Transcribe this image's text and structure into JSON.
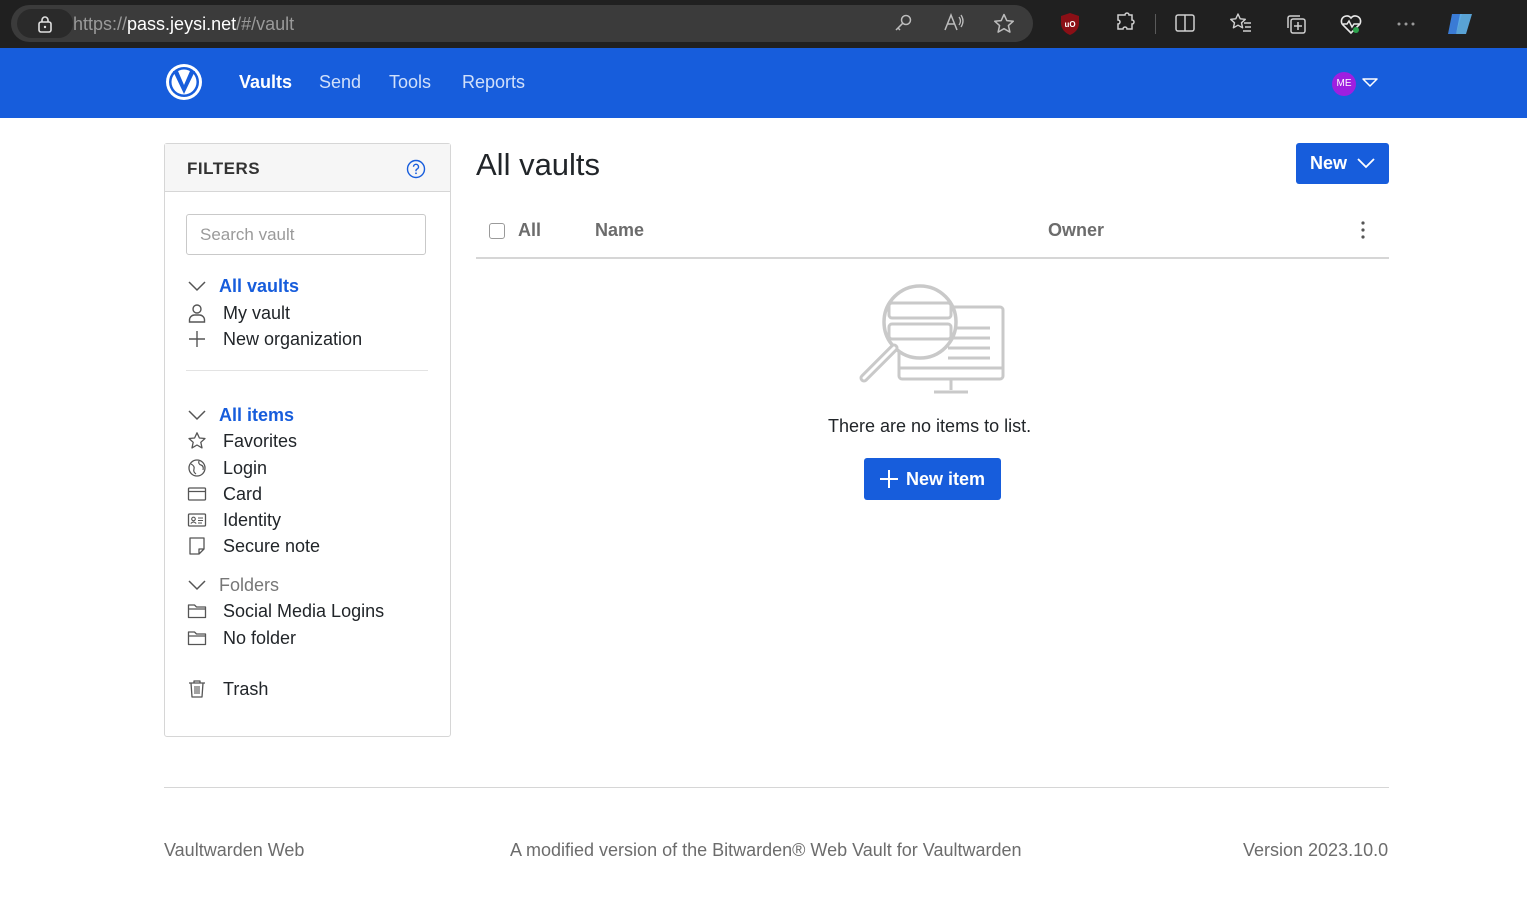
{
  "browser": {
    "url_protocol": "https://",
    "url_host": "pass.jeysi.net",
    "url_path": "/#/vault"
  },
  "nav": {
    "links": [
      {
        "label": "Vaults",
        "active": true
      },
      {
        "label": "Send",
        "active": false
      },
      {
        "label": "Tools",
        "active": false
      },
      {
        "label": "Reports",
        "active": false
      }
    ],
    "avatar_initials": "ME"
  },
  "filters": {
    "title": "FILTERS",
    "search_placeholder": "Search vault",
    "vaults_heading": "All vaults",
    "vaults": [
      {
        "label": "My vault",
        "icon": "user-icon"
      },
      {
        "label": "New organization",
        "icon": "plus-icon"
      }
    ],
    "items_heading": "All items",
    "items": [
      {
        "label": "Favorites",
        "icon": "star-icon"
      },
      {
        "label": "Login",
        "icon": "globe-icon"
      },
      {
        "label": "Card",
        "icon": "credit-card-icon"
      },
      {
        "label": "Identity",
        "icon": "id-card-icon"
      },
      {
        "label": "Secure note",
        "icon": "note-icon"
      }
    ],
    "folders_heading": "Folders",
    "folders": [
      {
        "label": "Social Media Logins",
        "icon": "folder-icon"
      },
      {
        "label": "No folder",
        "icon": "folder-icon"
      }
    ],
    "trash_label": "Trash"
  },
  "main": {
    "title": "All vaults",
    "new_button": "New",
    "table_headers": {
      "all": "All",
      "name": "Name",
      "owner": "Owner"
    },
    "empty_text": "There are no items to list.",
    "new_item_button": "New item"
  },
  "footer": {
    "left": "Vaultwarden Web",
    "center": "A modified version of the Bitwarden® Web Vault for Vaultwarden",
    "right": "Version 2023.10.0"
  },
  "colors": {
    "brand": "#175ddc",
    "avatar": "#9e1fe0"
  }
}
